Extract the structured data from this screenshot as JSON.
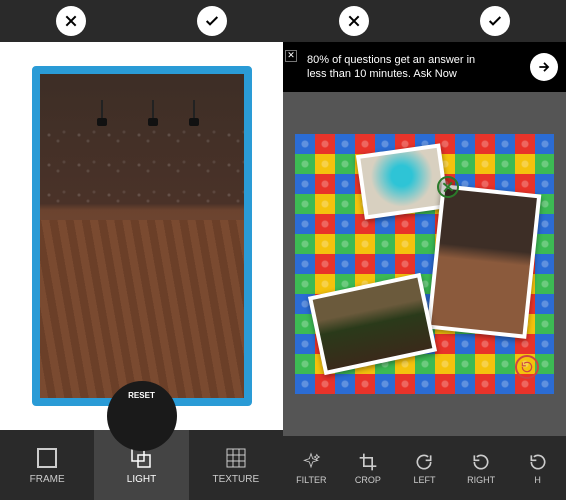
{
  "left": {
    "topbar": {
      "cancel": "cancel",
      "confirm": "confirm"
    },
    "reset_label": "RESET",
    "tools": [
      {
        "id": "frame",
        "label": "FRAME"
      },
      {
        "id": "light",
        "label": "LIGHT",
        "active": true
      },
      {
        "id": "texture",
        "label": "TEXTURE"
      }
    ]
  },
  "right": {
    "topbar": {
      "cancel": "cancel",
      "confirm": "confirm"
    },
    "ad": {
      "text": "80% of questions get an answer in less than 10 minutes. Ask Now"
    },
    "tools": [
      {
        "id": "filter",
        "label": "FILTER"
      },
      {
        "id": "crop",
        "label": "CROP"
      },
      {
        "id": "left",
        "label": "LEFT"
      },
      {
        "id": "right",
        "label": "RIGHT"
      },
      {
        "id": "next",
        "label": "H"
      }
    ]
  }
}
